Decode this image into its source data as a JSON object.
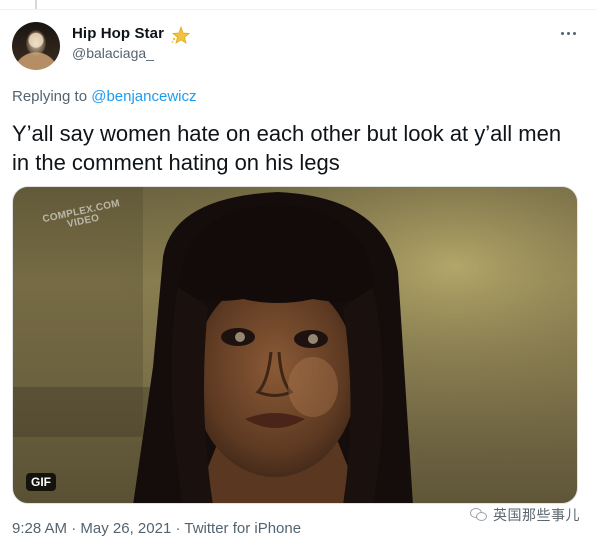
{
  "author": {
    "display_name": "Hip Hop Star",
    "handle": "@balaciaga_",
    "badge_icon": "star-emoji-icon"
  },
  "reply": {
    "prefix": "Replying to ",
    "handle": "@benjancewicz"
  },
  "tweet": {
    "text_line1": "Y’all say women hate on each other but look at y’all men",
    "text_line2": "in the comment hating on his legs"
  },
  "media": {
    "watermark_top": "COMPLEX.COM",
    "watermark_bottom": "VIDEO",
    "gif_label": "GIF"
  },
  "meta": {
    "time": "9:28 AM",
    "separator1": " · ",
    "date": "May 26, 2021",
    "separator2": " · ",
    "source": "Twitter for iPhone"
  },
  "watermark_corner": {
    "label": "英国那些事儿",
    "icon": "wechat-icon"
  },
  "colors": {
    "link": "#1d9bf0",
    "secondary_text": "#536471",
    "primary_text": "#0f1419"
  }
}
